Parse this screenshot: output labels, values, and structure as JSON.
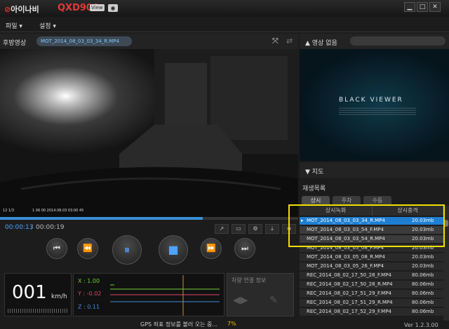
{
  "titlebar": {
    "brand": "아이나비",
    "model": "QXD900",
    "view_tag": "View",
    "min": "▁",
    "max": "□",
    "close": "✕"
  },
  "menu": {
    "file": "파일 ▾",
    "settings": "설정 ▾"
  },
  "player": {
    "channel_label": "후방영상",
    "filename": "MOT_2014_08_03_03_34_R.MP4",
    "time_current": "00:00:13",
    "time_separator": "/",
    "time_total": "00:00:19",
    "seek_progress": 0.68,
    "overlay_left": "12 1/3",
    "overlay_right": "1 06 00  2014.08.03 03:00 45"
  },
  "speed": {
    "value": "001",
    "unit": "km/h"
  },
  "gsensor": {
    "x": "X : 1.00",
    "y": "Y : -0.02",
    "z": "Z : 0.11",
    "x_color": "#6fcf3a",
    "y_color": "#e0456e",
    "z_color": "#3d8be0"
  },
  "vehicle": {
    "title": "차량 연결 정보"
  },
  "status": {
    "text": "GPS 좌표 정보를 불러 오는 중...",
    "percent": "7%"
  },
  "right": {
    "no_video": "영상 없음",
    "black_viewer": "BLACK VIEWER",
    "map_label": "지도",
    "record_list": "재생목록",
    "tabs": [
      "상시",
      "주차",
      "수동"
    ],
    "columns": [
      "상시녹화",
      "상시충격"
    ],
    "files": [
      {
        "name": "MOT_2014_08_03_03_34_R.MP4",
        "size": "20.03mb",
        "state": "sel"
      },
      {
        "name": "MOT_2014_08_03_03_54_F.MP4",
        "size": "20.03mb",
        "state": "alt"
      },
      {
        "name": "MOT_2014_08_03_03_54_R.MP4",
        "size": "20.03mb",
        "state": "alt"
      },
      {
        "name": "MOT_2014_08_03_05_08_F.MP4",
        "size": "20.03mb",
        "state": "dim"
      },
      {
        "name": "MOT_2014_08_03_05_08_R.MP4",
        "size": "20.03mb",
        "state": "dim"
      },
      {
        "name": "MOT_2014_08_03_05_26_F.MP4",
        "size": "20.03mb",
        "state": "dim"
      },
      {
        "name": "REC_2014_08_02_17_50_28_F.MP4",
        "size": "80.06mb",
        "state": "dim"
      },
      {
        "name": "REC_2014_08_02_17_50_28_R.MP4",
        "size": "80.06mb",
        "state": "dim"
      },
      {
        "name": "REC_2014_08_02_17_51_29_F.MP4",
        "size": "80.06mb",
        "state": "dim"
      },
      {
        "name": "REC_2014_08_02_17_51_29_R.MP4",
        "size": "80.06mb",
        "state": "dim"
      },
      {
        "name": "REC_2014_08_02_17_52_29_F.MP4",
        "size": "80.06mb",
        "state": "dim"
      }
    ],
    "version": "Ver 1.2.3.00"
  }
}
